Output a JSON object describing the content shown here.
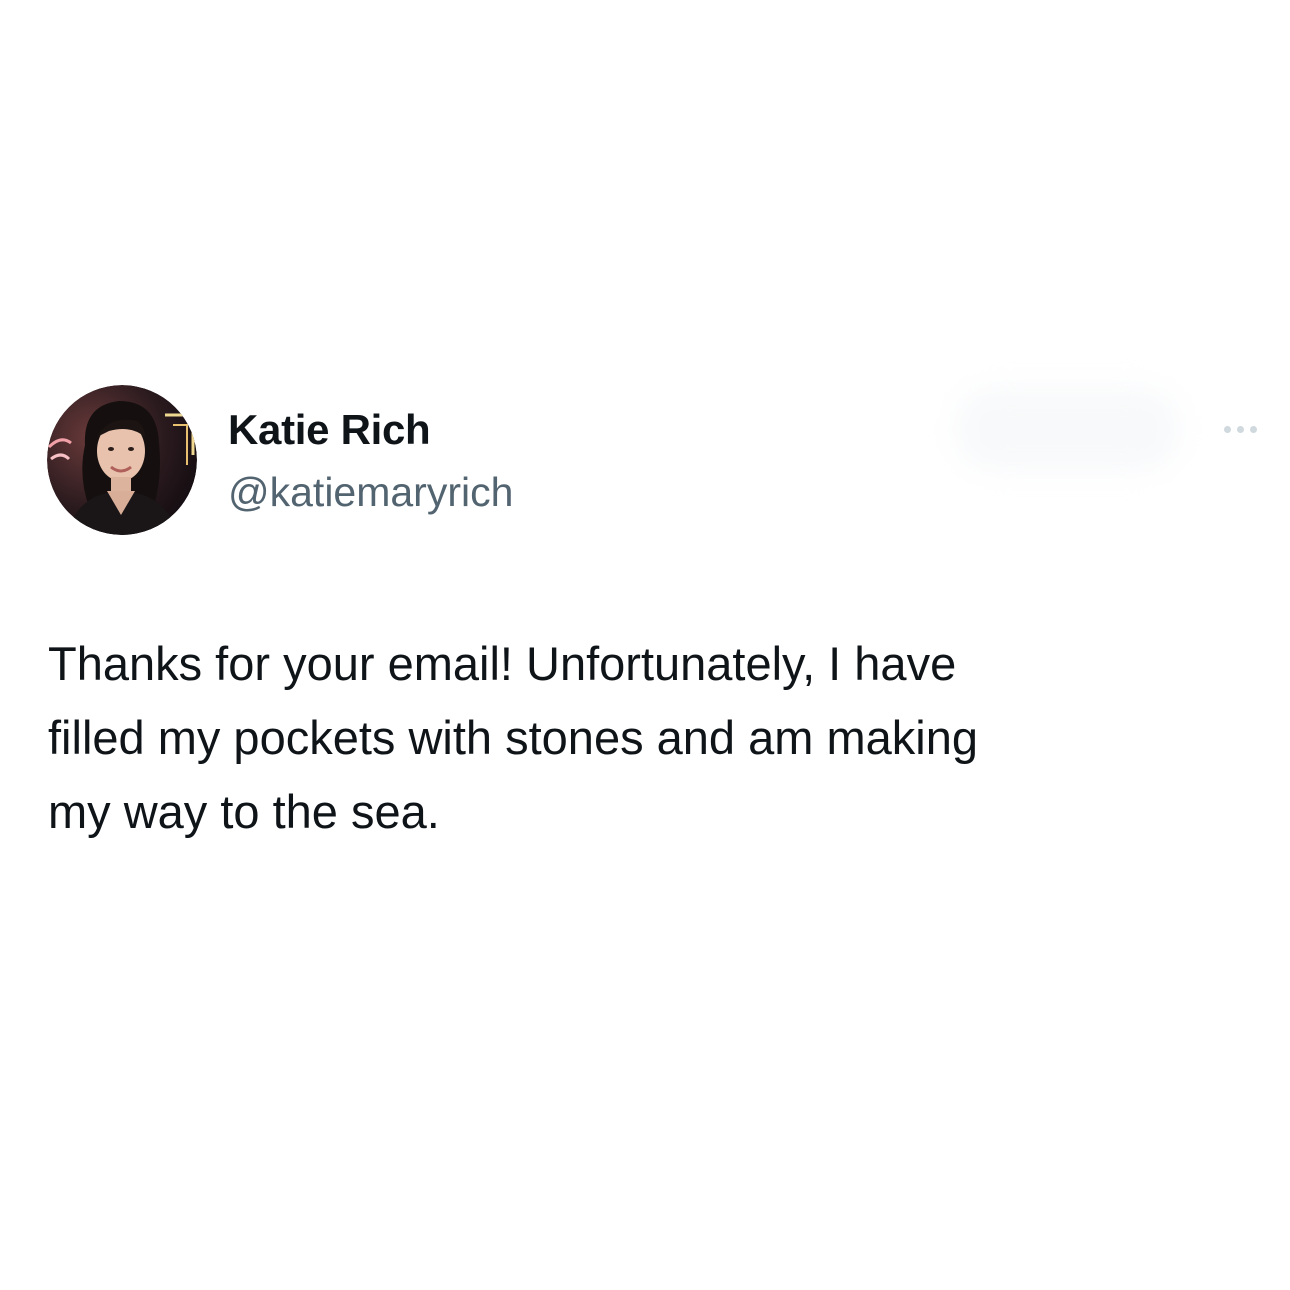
{
  "author": {
    "display_name": "Katie Rich",
    "handle": "@katiemaryrich",
    "avatar_icon": "profile-photo"
  },
  "actions": {
    "more_icon": "more-horizontal-icon"
  },
  "tweet": {
    "lines": [
      "Thanks for your email! Unfortunately, I have",
      "filled my pockets with stones and am making",
      "my way to the sea."
    ]
  },
  "colors": {
    "text_primary": "#0f1419",
    "text_secondary": "#536471",
    "background": "#ffffff",
    "more_dots": "#cfd9de"
  }
}
